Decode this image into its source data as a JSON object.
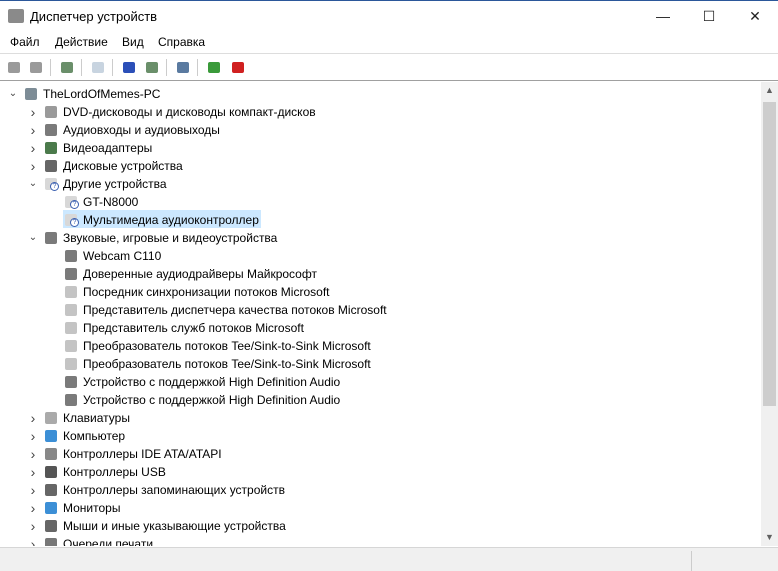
{
  "window": {
    "title": "Диспетчер устройств",
    "minimize": "—",
    "maximize": "☐",
    "close": "✕"
  },
  "menu": [
    "Файл",
    "Действие",
    "Вид",
    "Справка"
  ],
  "toolbar": [
    "back-icon",
    "forward-icon",
    "properties-pane-icon",
    "properties-icon",
    "help-icon",
    "action-pane-icon",
    "scan-hardware-icon",
    "update-driver-icon",
    "uninstall-device-icon"
  ],
  "tree": [
    {
      "level": 0,
      "expanded": true,
      "label": "TheLordOfMemes-PC",
      "icon": "computer-icon"
    },
    {
      "level": 1,
      "expanded": false,
      "label": "DVD-дисководы и дисководы компакт-дисков",
      "icon": "dvd-icon"
    },
    {
      "level": 1,
      "expanded": false,
      "label": "Аудиовходы и аудиовыходы",
      "icon": "speaker-icon"
    },
    {
      "level": 1,
      "expanded": false,
      "label": "Видеоадаптеры",
      "icon": "display-adapter-icon"
    },
    {
      "level": 1,
      "expanded": false,
      "label": "Дисковые устройства",
      "icon": "disk-icon"
    },
    {
      "level": 1,
      "expanded": true,
      "label": "Другие устройства",
      "icon": "unknown-device-icon"
    },
    {
      "level": 2,
      "label": "GT-N8000",
      "icon": "unknown-device-icon"
    },
    {
      "level": 2,
      "label": "Мультимедиа аудиоконтроллер",
      "icon": "unknown-device-icon",
      "selected": true
    },
    {
      "level": 1,
      "expanded": true,
      "label": "Звуковые, игровые и видеоустройства",
      "icon": "speaker-icon"
    },
    {
      "level": 2,
      "label": "Webcam C110",
      "icon": "speaker-icon"
    },
    {
      "level": 2,
      "label": "Доверенные аудиодрайверы Майкрософт",
      "icon": "speaker-icon"
    },
    {
      "level": 2,
      "label": "Посредник синхронизации потоков Microsoft",
      "icon": "speaker-disabled-icon"
    },
    {
      "level": 2,
      "label": "Представитель диспетчера качества потоков Microsoft",
      "icon": "speaker-disabled-icon"
    },
    {
      "level": 2,
      "label": "Представитель служб потоков Microsoft",
      "icon": "speaker-disabled-icon"
    },
    {
      "level": 2,
      "label": "Преобразователь потоков Tee/Sink-to-Sink Microsoft",
      "icon": "speaker-disabled-icon"
    },
    {
      "level": 2,
      "label": "Преобразователь потоков Tee/Sink-to-Sink Microsoft",
      "icon": "speaker-disabled-icon"
    },
    {
      "level": 2,
      "label": "Устройство с поддержкой High Definition Audio",
      "icon": "speaker-icon"
    },
    {
      "level": 2,
      "label": "Устройство с поддержкой High Definition Audio",
      "icon": "speaker-icon"
    },
    {
      "level": 1,
      "expanded": false,
      "label": "Клавиатуры",
      "icon": "keyboard-icon"
    },
    {
      "level": 1,
      "expanded": false,
      "label": "Компьютер",
      "icon": "monitor-icon"
    },
    {
      "level": 1,
      "expanded": false,
      "label": "Контроллеры IDE ATA/ATAPI",
      "icon": "ide-controller-icon"
    },
    {
      "level": 1,
      "expanded": false,
      "label": "Контроллеры USB",
      "icon": "usb-icon"
    },
    {
      "level": 1,
      "expanded": false,
      "label": "Контроллеры запоминающих устройств",
      "icon": "storage-controller-icon"
    },
    {
      "level": 1,
      "expanded": false,
      "label": "Мониторы",
      "icon": "monitor-icon"
    },
    {
      "level": 1,
      "expanded": false,
      "label": "Мыши и иные указывающие устройства",
      "icon": "mouse-icon"
    },
    {
      "level": 1,
      "expanded": false,
      "label": "Очереди печати",
      "icon": "printer-icon"
    }
  ]
}
